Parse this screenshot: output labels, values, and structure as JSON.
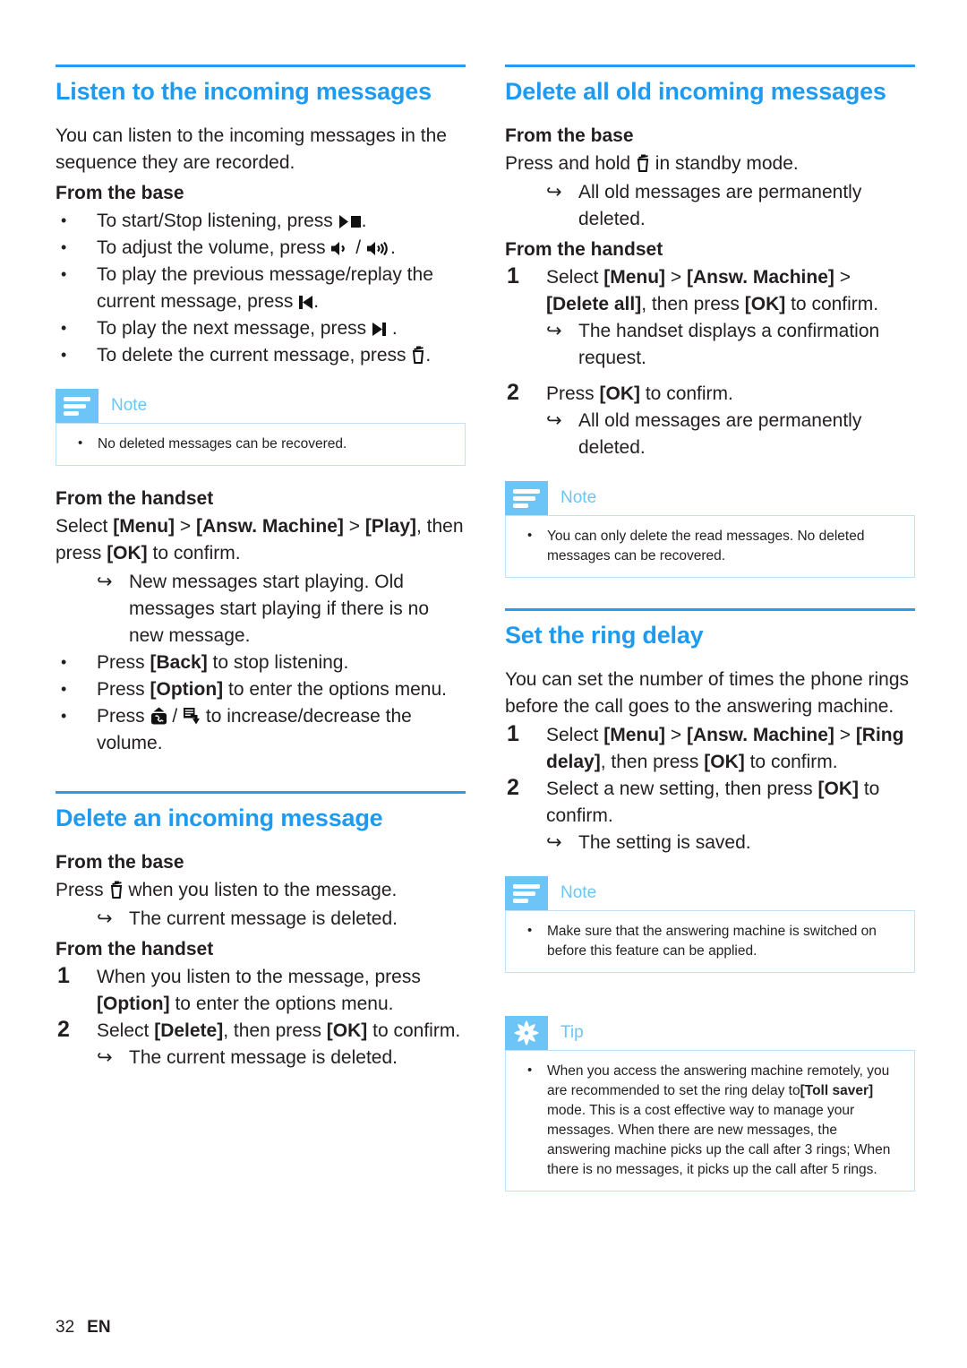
{
  "page": {
    "number": "32",
    "language": "EN"
  },
  "colors": {
    "heading_blue": "#1e9af0",
    "rule_blue": "#2b9bf0",
    "callout_blue": "#6dc5f7",
    "callout_border": "#bfe2fa",
    "text": "#231f20"
  },
  "left_column": {
    "section1": {
      "heading": "Listen to the incoming messages",
      "intro": "You can listen to the incoming messages in the sequence they are recorded.",
      "sub_base": "From the base",
      "base_bullets": [
        {
          "pre": "To start/Stop listening, press ",
          "icon": "play-stop-icon",
          "post": "."
        },
        {
          "pre": "To adjust the volume, press ",
          "icon": "volume-down-icon",
          "mid": " / ",
          "icon2": "volume-up-icon",
          "post": "."
        },
        {
          "pre": "To play the previous message/replay the current message, press ",
          "icon": "previous-track-icon",
          "post": "."
        },
        {
          "pre": "To play the next message, press ",
          "icon": "next-track-icon",
          "post": " ."
        },
        {
          "pre": "To delete the current message, press ",
          "icon": "trash-icon",
          "post": "."
        }
      ],
      "note": {
        "title": "Note",
        "icon": "note-lines-icon",
        "items": [
          "No deleted messages can be recovered."
        ]
      },
      "sub_handset": "From the handset",
      "handset_select": {
        "t1": "Select ",
        "b1": "[Menu]",
        "t2": " > ",
        "b2": "[Answ. Machine]",
        "t3": " > ",
        "b3": "[Play]",
        "t4": ", then press ",
        "b4": "[OK]",
        "t5": " to confirm."
      },
      "handset_result": "New messages start playing. Old messages start playing if there is no new message.",
      "handset_bullets": [
        {
          "t1": "Press ",
          "b1": "[Back]",
          "t2": " to stop listening."
        },
        {
          "t1": "Press ",
          "b1": "[Option]",
          "t2": " to enter the options menu."
        },
        {
          "t1": "Press ",
          "icon": "phone-up-icon",
          "mid": " / ",
          "icon2": "list-down-icon",
          "t2": " to increase/decrease the volume."
        }
      ]
    },
    "section2": {
      "heading": "Delete an incoming message",
      "sub_base": "From the base",
      "base_line": {
        "t1": "Press ",
        "icon": "trash-icon",
        "t2": " when you listen to the message."
      },
      "base_result": "The current message is deleted.",
      "sub_handset": "From the handset",
      "steps": [
        {
          "num": "1",
          "t1": "When you listen to the message, press ",
          "b1": "[Option]",
          "t2": " to enter the options menu."
        },
        {
          "num": "2",
          "t1": "Select ",
          "b1": "[Delete]",
          "t2": ", then press ",
          "b2": "[OK]",
          "t3": " to confirm."
        }
      ],
      "step_result": "The current message is deleted."
    }
  },
  "right_column": {
    "section1": {
      "heading": "Delete all old incoming messages",
      "sub_base": "From the base",
      "base_line": {
        "t1": "Press and hold ",
        "icon": "trash-icon",
        "t2": " in standby mode."
      },
      "base_result": "All old messages are permanently deleted.",
      "sub_handset": "From the handset",
      "steps": [
        {
          "num": "1",
          "t1": "Select ",
          "b1": "[Menu]",
          "t2": " > ",
          "b2": "[Answ. Machine]",
          "t3": " > ",
          "b3": "[Delete all]",
          "t4": ", then press ",
          "b4": "[OK]",
          "t5": " to confirm.",
          "result": "The handset displays a confirmation request."
        },
        {
          "num": "2",
          "t1": "Press ",
          "b1": "[OK]",
          "t2": " to confirm.",
          "result": "All old messages are permanently deleted."
        }
      ],
      "note": {
        "title": "Note",
        "icon": "note-lines-icon",
        "items": [
          "You can only delete the read messages. No deleted messages can be recovered."
        ]
      }
    },
    "section2": {
      "heading": "Set the ring delay",
      "intro": "You can set the number of times the phone rings before the call goes to the answering machine.",
      "steps": [
        {
          "num": "1",
          "t1": "Select ",
          "b1": "[Menu]",
          "t2": " > ",
          "b2": "[Answ. Machine]",
          "t3": " > ",
          "b3": "[Ring delay]",
          "t4": ", then press ",
          "b4": "[OK]",
          "t5": " to confirm."
        },
        {
          "num": "2",
          "t1": "Select a new setting, then press ",
          "b1": "[OK]",
          "t2": " to confirm.",
          "result": "The setting is saved."
        }
      ],
      "note": {
        "title": "Note",
        "icon": "note-lines-icon",
        "items": [
          "Make sure that the answering machine is switched on before this feature can be applied."
        ]
      },
      "tip": {
        "title": "Tip",
        "icon": "asterisk-icon",
        "text_pre": "When you access the answering machine remotely, you are recommended to set the ring delay to",
        "text_bold": "[Toll saver]",
        "text_post": " mode. This is a cost effective way to manage your messages. When there are new messages, the answering machine picks up the call after 3 rings; When there is no messages, it picks up the call after 5 rings."
      }
    }
  }
}
